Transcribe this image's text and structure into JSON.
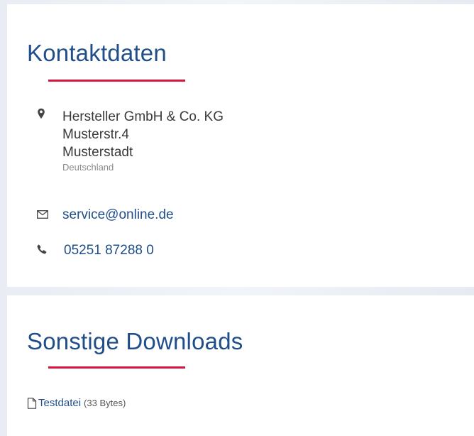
{
  "contact": {
    "heading": "Kontaktdaten",
    "address": {
      "icon": "map-pin-icon",
      "company": "Hersteller GmbH & Co. KG",
      "street": "Musterstr.4",
      "city": "Musterstadt",
      "country": "Deutschland"
    },
    "email": {
      "icon": "envelope-icon",
      "value": "service@online.de"
    },
    "phone": {
      "icon": "phone-icon",
      "value": "05251 87288 0"
    }
  },
  "downloads": {
    "heading": "Sonstige Downloads",
    "items": [
      {
        "icon": "file-icon",
        "label": "Testdatei",
        "size": "(33 Bytes)"
      }
    ]
  },
  "colors": {
    "heading": "#1f4e8a",
    "accent_underline": "#d7163f",
    "link": "#1f4e8a",
    "text": "#3a3a3a",
    "muted": "#8a8a8a",
    "background": "#ecf0f5"
  }
}
